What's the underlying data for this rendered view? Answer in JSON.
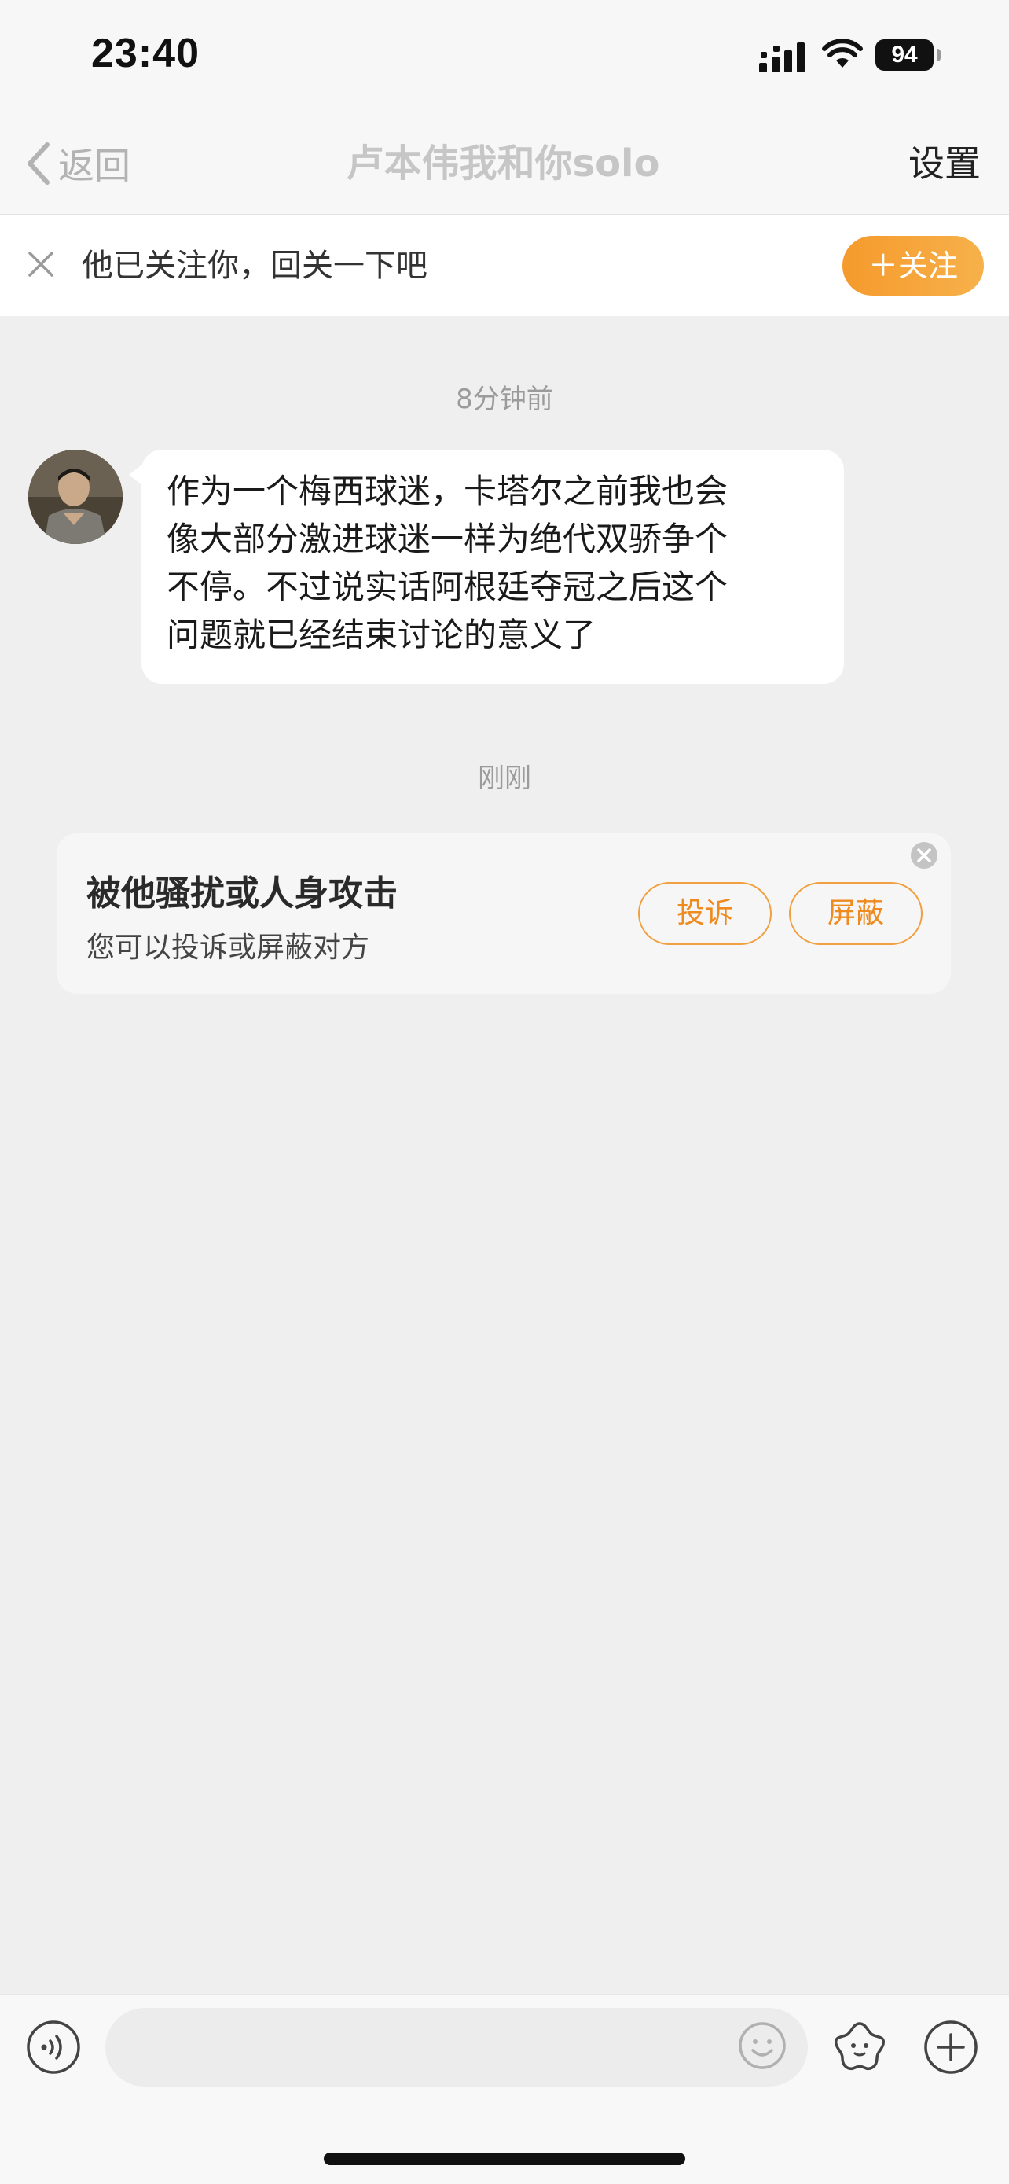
{
  "status_bar": {
    "time": "23:40",
    "battery": "94",
    "icons": [
      "signal-icon",
      "wifi-icon",
      "battery-icon"
    ]
  },
  "nav": {
    "back_label": "返回",
    "title": "卢本伟我和你solo",
    "settings_label": "设置"
  },
  "follow_banner": {
    "text": "他已关注你，回关一下吧",
    "button_label": "＋关注"
  },
  "messages": [
    {
      "timestamp": "8分钟前",
      "sender": "other",
      "lines": [
        "作为一个梅西球迷，卡塔尔之前我也会",
        "像大部分激进球迷一样为绝代双骄争个",
        "不停。不过说实话阿根廷夺冠之后这个",
        "问题就已经结束讨论的意义了"
      ]
    }
  ],
  "second_timestamp": "刚刚",
  "report_card": {
    "title": "被他骚扰或人身攻击",
    "subtitle": "您可以投诉或屏蔽对方",
    "complain_label": "投诉",
    "block_label": "屏蔽"
  },
  "input_bar": {
    "placeholder": "",
    "icons": [
      "voice-icon",
      "emoji-icon",
      "sticker-icon",
      "add-icon"
    ]
  },
  "colors": {
    "accent": "#f5a033",
    "chat_background": "#efefef",
    "bubble": "#ffffff"
  }
}
